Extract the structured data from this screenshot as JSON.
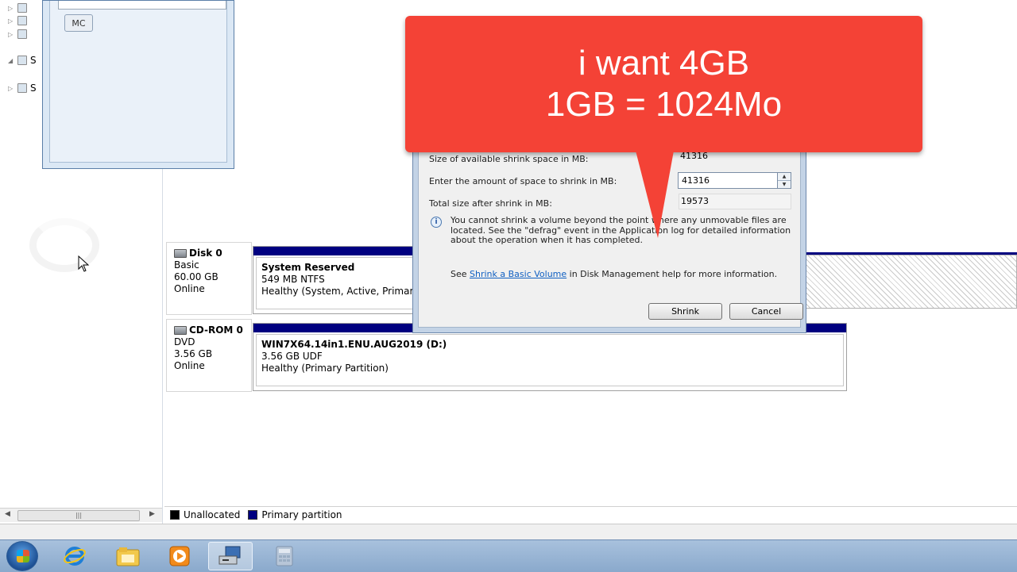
{
  "small_window": {
    "mc_button_label": "MC"
  },
  "tree": {
    "items": [
      "S",
      "S"
    ]
  },
  "disks": [
    {
      "name": "Disk 0",
      "type": "Basic",
      "size": "60.00 GB",
      "status": "Online",
      "volume": {
        "name": "System Reserved",
        "detail": "549 MB NTFS",
        "health": "Healthy (System, Active, Primary P"
      }
    },
    {
      "name": "CD-ROM 0",
      "type": "DVD",
      "size": "3.56 GB",
      "status": "Online",
      "volume": {
        "name": "WIN7X64.14in1.ENU.AUG2019  (D:)",
        "detail": "3.56 GB UDF",
        "health": "Healthy (Primary Partition)"
      }
    }
  ],
  "legend": {
    "unallocated": "Unallocated",
    "primary": "Primary partition"
  },
  "colors": {
    "unallocated": "#000000",
    "primary": "#000080",
    "callout": "#f44236"
  },
  "shrink_dialog": {
    "available_label": "Size of available shrink space in MB:",
    "available_value": "41316",
    "amount_label": "Enter the amount of space to shrink in MB:",
    "amount_value": "41316",
    "total_label": "Total size after shrink in MB:",
    "total_value": "19573",
    "info_text": "You cannot shrink a volume beyond the point where any unmovable files are located. See the \"defrag\" event in the Application log for detailed information about the operation when it has completed.",
    "help_prefix": "See ",
    "help_link": "Shrink a Basic Volume",
    "help_suffix": " in Disk Management help for more information.",
    "shrink_button": "Shrink",
    "cancel_button": "Cancel"
  },
  "callout": {
    "line1": "i want 4GB",
    "line2": "1GB = 1024Mo"
  },
  "taskbar": {
    "items": [
      "start-orb",
      "internet-explorer-icon",
      "file-explorer-icon",
      "media-player-icon",
      "disk-management-icon",
      "calculator-icon"
    ]
  }
}
